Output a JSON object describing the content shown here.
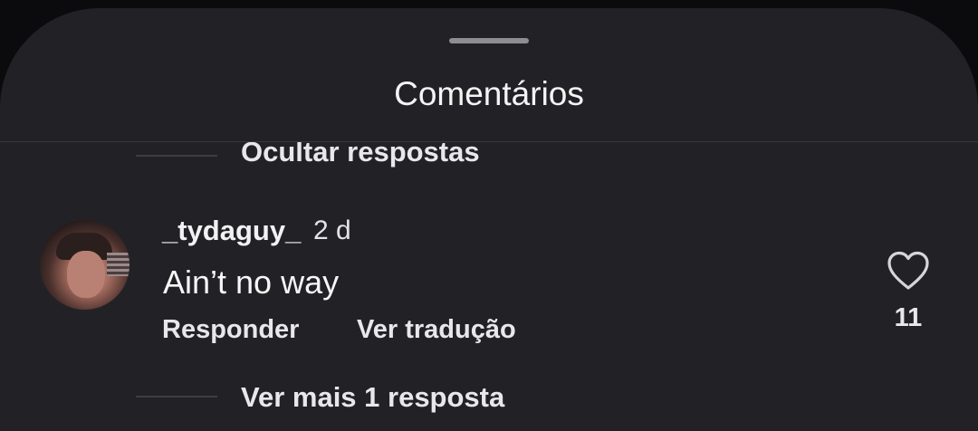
{
  "sheet": {
    "title": "Comentários"
  },
  "thread_above": {
    "hide_replies_label": "Ocultar respostas"
  },
  "comment": {
    "username": "_tydaguy_",
    "time": "2 d",
    "text": "Ain’t no way",
    "reply_label": "Responder",
    "translate_label": "Ver tradução",
    "like_icon": "heart-outline-icon",
    "like_count": "11",
    "more_replies_label": "Ver mais 1 resposta"
  },
  "colors": {
    "sheet_background": "#222226",
    "text_primary": "#f4f4f5",
    "divider": "#38383d"
  }
}
